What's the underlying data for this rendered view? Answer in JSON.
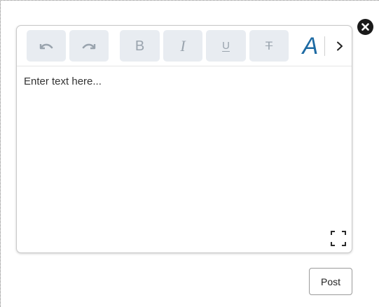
{
  "editor": {
    "placeholder": "Enter text here...",
    "toolbar": {
      "undo_icon": "undo-icon",
      "redo_icon": "redo-icon",
      "bold_label": "B",
      "italic_label": "I",
      "underline_label": "U",
      "strikethrough_label": "T",
      "font_color_label": "A",
      "more_icon": "chevron-right-icon"
    },
    "fullscreen_icon": "expand-icon"
  },
  "actions": {
    "post_label": "Post",
    "close_icon": "close-icon"
  },
  "colors": {
    "toolbar_button_bg": "#e8ecf1",
    "toolbar_icon": "#9aa4ae",
    "font_color_accent": "#1d6aa3",
    "close_button_bg": "#1a1a1a"
  }
}
